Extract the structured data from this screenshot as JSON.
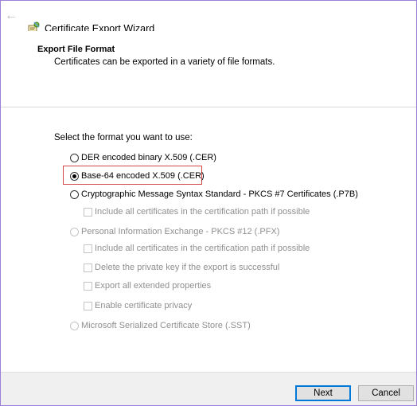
{
  "window": {
    "title": "Certificate Export Wizard",
    "back_icon": "arrow-left-icon",
    "app_icon": "certificate-wizard-icon",
    "accent_border": "#9c7fd6"
  },
  "header": {
    "heading": "Export File Format",
    "description": "Certificates can be exported in a variety of file formats."
  },
  "main": {
    "prompt": "Select the format you want to use:",
    "options": [
      {
        "label": "DER encoded binary X.509 (.CER)",
        "type": "radio",
        "checked": false,
        "disabled": false
      },
      {
        "label": "Base-64 encoded X.509 (.CER)",
        "type": "radio",
        "checked": true,
        "disabled": false,
        "highlighted": true
      },
      {
        "label": "Cryptographic Message Syntax Standard - PKCS #7 Certificates (.P7B)",
        "type": "radio",
        "checked": false,
        "disabled": false
      },
      {
        "label": "Include all certificates in the certification path if possible",
        "type": "checkbox",
        "checked": false,
        "disabled": true
      },
      {
        "label": "Personal Information Exchange - PKCS #12 (.PFX)",
        "type": "radio",
        "checked": false,
        "disabled": true
      },
      {
        "label": "Include all certificates in the certification path if possible",
        "type": "checkbox",
        "checked": false,
        "disabled": true
      },
      {
        "label": "Delete the private key if the export is successful",
        "type": "checkbox",
        "checked": false,
        "disabled": true
      },
      {
        "label": "Export all extended properties",
        "type": "checkbox",
        "checked": false,
        "disabled": true
      },
      {
        "label": "Enable certificate privacy",
        "type": "checkbox",
        "checked": false,
        "disabled": true
      },
      {
        "label": "Microsoft Serialized Certificate Store (.SST)",
        "type": "radio",
        "checked": false,
        "disabled": true
      }
    ],
    "highlight_color": "#d64545"
  },
  "footer": {
    "next_label": "Next",
    "cancel_label": "Cancel",
    "primary_border_color": "#0078d7"
  }
}
